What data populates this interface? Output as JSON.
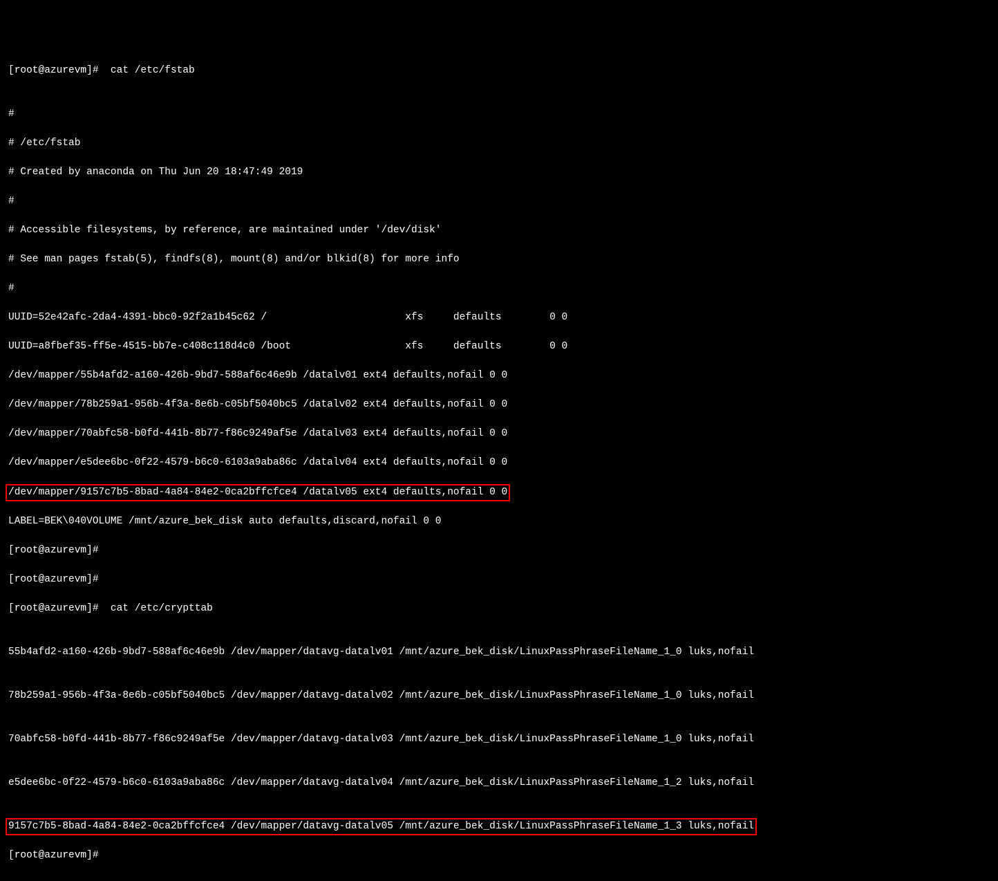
{
  "lines": {
    "l1": "[root@azurevm]#  cat /etc/fstab",
    "l2": "",
    "l3": "#",
    "l4": "# /etc/fstab",
    "l5": "# Created by anaconda on Thu Jun 20 18:47:49 2019",
    "l6": "#",
    "l7": "# Accessible filesystems, by reference, are maintained under '/dev/disk'",
    "l8": "# See man pages fstab(5), findfs(8), mount(8) and/or blkid(8) for more info",
    "l9": "#",
    "l10": "UUID=52e42afc-2da4-4391-bbc0-92f2a1b45c62 /                       xfs     defaults        0 0",
    "l11": "UUID=a8fbef35-ff5e-4515-bb7e-c408c118d4c0 /boot                   xfs     defaults        0 0",
    "l12": "/dev/mapper/55b4afd2-a160-426b-9bd7-588af6c46e9b /datalv01 ext4 defaults,nofail 0 0",
    "l13": "/dev/mapper/78b259a1-956b-4f3a-8e6b-c05bf5040bc5 /datalv02 ext4 defaults,nofail 0 0",
    "l14": "/dev/mapper/70abfc58-b0fd-441b-8b77-f86c9249af5e /datalv03 ext4 defaults,nofail 0 0",
    "l15": "/dev/mapper/e5dee6bc-0f22-4579-b6c0-6103a9aba86c /datalv04 ext4 defaults,nofail 0 0",
    "l16": "/dev/mapper/9157c7b5-8bad-4a84-84e2-0ca2bffcfce4 /datalv05 ext4 defaults,nofail 0 0",
    "l17": "LABEL=BEK\\040VOLUME /mnt/azure_bek_disk auto defaults,discard,nofail 0 0",
    "l18": "[root@azurevm]#",
    "l19": "[root@azurevm]#",
    "l20": "[root@azurevm]#  cat /etc/crypttab",
    "l21": "",
    "l22": "55b4afd2-a160-426b-9bd7-588af6c46e9b /dev/mapper/datavg-datalv01 /mnt/azure_bek_disk/LinuxPassPhraseFileName_1_0 luks,nofail",
    "l23": "",
    "l24": "78b259a1-956b-4f3a-8e6b-c05bf5040bc5 /dev/mapper/datavg-datalv02 /mnt/azure_bek_disk/LinuxPassPhraseFileName_1_0 luks,nofail",
    "l25": "",
    "l26": "70abfc58-b0fd-441b-8b77-f86c9249af5e /dev/mapper/datavg-datalv03 /mnt/azure_bek_disk/LinuxPassPhraseFileName_1_0 luks,nofail",
    "l27": "",
    "l28": "e5dee6bc-0f22-4579-b6c0-6103a9aba86c /dev/mapper/datavg-datalv04 /mnt/azure_bek_disk/LinuxPassPhraseFileName_1_2 luks,nofail",
    "l29": "",
    "l30": "9157c7b5-8bad-4a84-84e2-0ca2bffcfce4 /dev/mapper/datavg-datalv05 /mnt/azure_bek_disk/LinuxPassPhraseFileName_1_3 luks,nofail",
    "l31": "[root@azurevm]#"
  }
}
